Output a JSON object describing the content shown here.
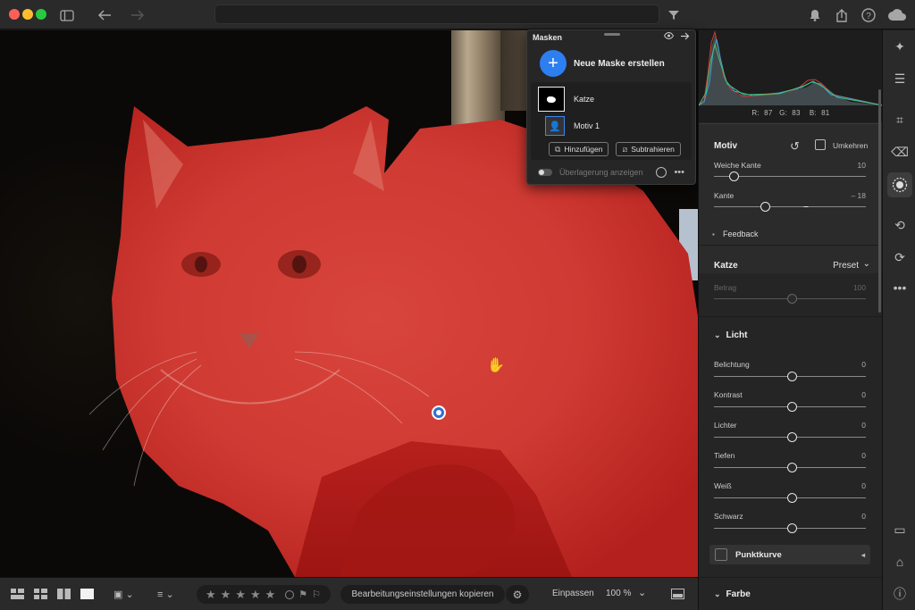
{
  "titlebar": {
    "icons": [
      "sidebar-toggle-icon",
      "back-arrow-icon",
      "forward-arrow-icon",
      "filter-icon",
      "bell-icon",
      "share-icon",
      "help-icon",
      "cloud-icon"
    ]
  },
  "masks_panel": {
    "title": "Masken",
    "create_label": "Neue Maske erstellen",
    "mask_name": "Katze",
    "component_name": "Motiv 1",
    "add_label": "Hinzufügen",
    "subtract_label": "Subtrahieren",
    "overlay_label": "Überlagerung anzeigen",
    "more_label": "•••"
  },
  "histogram": {
    "r_label": "R:",
    "r_value": "87",
    "g_label": "G:",
    "g_value": "83",
    "b_label": "B:",
    "b_value": "81"
  },
  "motiv_section": {
    "title": "Motiv",
    "invert_label": "Umkehren",
    "sliders": [
      {
        "label": "Weiche Kante",
        "value": "10",
        "fraction": 0.1
      },
      {
        "label": "Kante",
        "value": "– 18",
        "fraction": 0.34
      }
    ],
    "feedback_label": "Feedback"
  },
  "katze_section": {
    "title": "Katze",
    "preset_label": "Preset",
    "amount_label": "Betrag",
    "amount_value": "100",
    "amount_fraction": 0.5
  },
  "licht_section": {
    "title": "Licht",
    "sliders": [
      {
        "label": "Belichtung",
        "value": "0"
      },
      {
        "label": "Kontrast",
        "value": "0"
      },
      {
        "label": "Lichter",
        "value": "0"
      },
      {
        "label": "Tiefen",
        "value": "0"
      },
      {
        "label": "Weiß",
        "value": "0"
      },
      {
        "label": "Schwarz",
        "value": "0"
      }
    ],
    "curve_label": "Punktkurve"
  },
  "farbe_section": {
    "title": "Farbe"
  },
  "bottombar": {
    "stars": [
      "★",
      "★",
      "★",
      "★",
      "★"
    ],
    "copy_label": "Bearbeitungseinstellungen kopieren",
    "fit_label": "Einpassen",
    "zoom_value": "100 %"
  },
  "colors": {
    "accent": "#2d7ff0",
    "mask_overlay": "#d42a26"
  }
}
